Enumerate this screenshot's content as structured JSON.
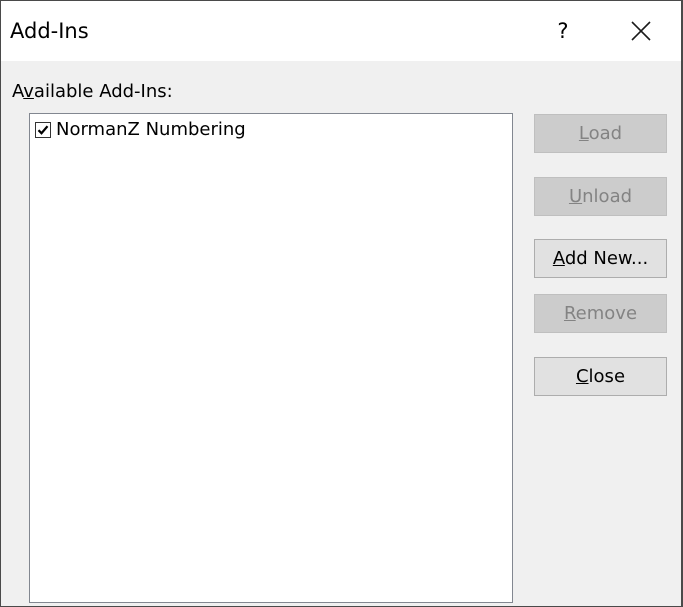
{
  "window": {
    "title": "Add-Ins",
    "help_label": "?"
  },
  "available": {
    "label_pre": "A",
    "label_acc": "v",
    "label_post": "ailable Add-Ins:"
  },
  "addins": [
    {
      "name": "NormanZ Numbering",
      "checked": true
    }
  ],
  "buttons": {
    "load": {
      "acc": "L",
      "rest": "oad",
      "enabled": false
    },
    "unload": {
      "acc": "U",
      "rest": "nload",
      "enabled": false
    },
    "addnew": {
      "acc": "A",
      "rest": "dd New...",
      "enabled": true
    },
    "remove": {
      "acc": "R",
      "rest": "emove",
      "enabled": false
    },
    "close": {
      "acc": "C",
      "rest": "lose",
      "enabled": true
    }
  },
  "icons": {
    "close_window": "close-icon",
    "checkbox": "checkmark-icon"
  }
}
